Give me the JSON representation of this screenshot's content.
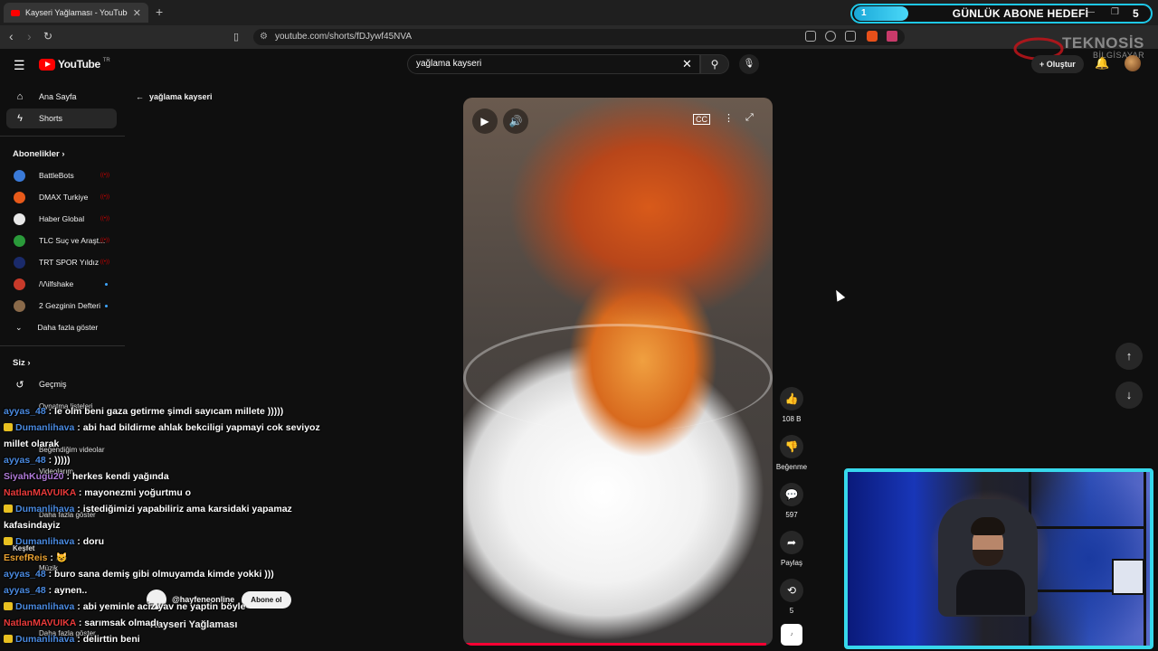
{
  "browser": {
    "tab_title": "Kayseri Yağlaması - YouTube",
    "tab_close": "✕",
    "new_tab": "+",
    "url": "youtube.com/shorts/fDJywf45NVA",
    "goal_current": "1",
    "goal_label": "GÜNLÜK ABONE HEDEFİ",
    "goal_target": "5",
    "watermark_top": "TEKNOSİS",
    "watermark_bottom": "BİLGİSAYAR"
  },
  "header": {
    "logo": "YouTube",
    "region": "TR",
    "search_value": "yağlama kayseri",
    "create_label": "+ Oluştur"
  },
  "sidebar": {
    "home": "Ana Sayfa",
    "shorts": "Shorts",
    "subscriptions_header": "Abonelikler",
    "subscriptions": [
      {
        "name": "BattleBots",
        "color": "#3a7ad8",
        "live": true
      },
      {
        "name": "DMAX Turkiye",
        "color": "#e85a1a",
        "live": true
      },
      {
        "name": "Haber Global",
        "color": "#e8e8e8",
        "live": true
      },
      {
        "name": "TLC Suç ve Araşt...",
        "color": "#2a9a3a",
        "live": true
      },
      {
        "name": "TRT SPOR Yıldız",
        "color": "#1a2a6a",
        "live": true
      },
      {
        "name": "/\\/\\ilfshake",
        "color": "#c83a2a",
        "live": false
      },
      {
        "name": "2 Gezginin Defteri",
        "color": "#8a6a4a",
        "live": false
      }
    ],
    "show_more": "Daha fazla göster",
    "you_header": "Siz",
    "history": "Geçmiş",
    "playlists": "Oynatma listeleri",
    "liked": "Beğendiğim videolar",
    "videos": "Videolarım",
    "show_more_2": "Daha fazla göster",
    "explore": "Keşfet",
    "music": "Müzik",
    "show_more_3": "Daha fazla göster"
  },
  "main": {
    "back_label": "yağlama kayseri",
    "channel_handle": "@hayfeneonline",
    "subscribe_label": "Abone ol",
    "short_title": "Kayseri Yağlaması",
    "like_count": "108 B",
    "dislike_label": "Beğenme",
    "comment_count": "597",
    "share_label": "Paylaş",
    "remix_count": "5",
    "progress_fraction": 0.98
  },
  "chat": [
    {
      "badge": false,
      "user": "ayyas_48",
      "user_color": "#4a8ae0",
      "text": " : le olm beni gaza getirme şimdi sayıcam millete )))))"
    },
    {
      "badge": true,
      "user": "Dumanlihava",
      "user_color": "#4a8ae0",
      "text": " : abi had bildirme ahlak bekciligi yapmayi cok seviyoz millet olarak"
    },
    {
      "badge": false,
      "user": "ayyas_48",
      "user_color": "#4a8ae0",
      "text": " : )))))"
    },
    {
      "badge": false,
      "user": "SiyahKugu20",
      "user_color": "#b07ad8",
      "text": " : herkes kendi yağında"
    },
    {
      "badge": false,
      "user": "NatlanMAVUIKA",
      "user_color": "#e83a3a",
      "text": " : mayonezmi yoğurtmu o"
    },
    {
      "badge": true,
      "user": "Dumanlihava",
      "user_color": "#4a8ae0",
      "text": " : istediğimizi yapabiliriz ama karsidaki yapamaz kafasindayiz"
    },
    {
      "badge": true,
      "user": "Dumanlihava",
      "user_color": "#4a8ae0",
      "text": " : doru"
    },
    {
      "badge": false,
      "user": "EsrefReis",
      "user_color": "#e8a030",
      "text": " : 😺"
    },
    {
      "badge": false,
      "user": "ayyas_48",
      "user_color": "#4a8ae0",
      "text": " : buro sana demiş gibi olmuyamda kimde yokki )))"
    },
    {
      "badge": false,
      "user": "ayyas_48",
      "user_color": "#4a8ae0",
      "text": " : aynen.."
    },
    {
      "badge": true,
      "user": "Dumanlihava",
      "user_color": "#4a8ae0",
      "text": " : abi yeminle aciz yav ne yaptin böyle"
    },
    {
      "badge": false,
      "user": "NatlanMAVUIKA",
      "user_color": "#e83a3a",
      "text": " : sarımsak olmadı"
    },
    {
      "badge": true,
      "user": "Dumanlihava",
      "user_color": "#4a8ae0",
      "text": " : delirttin beni"
    }
  ]
}
